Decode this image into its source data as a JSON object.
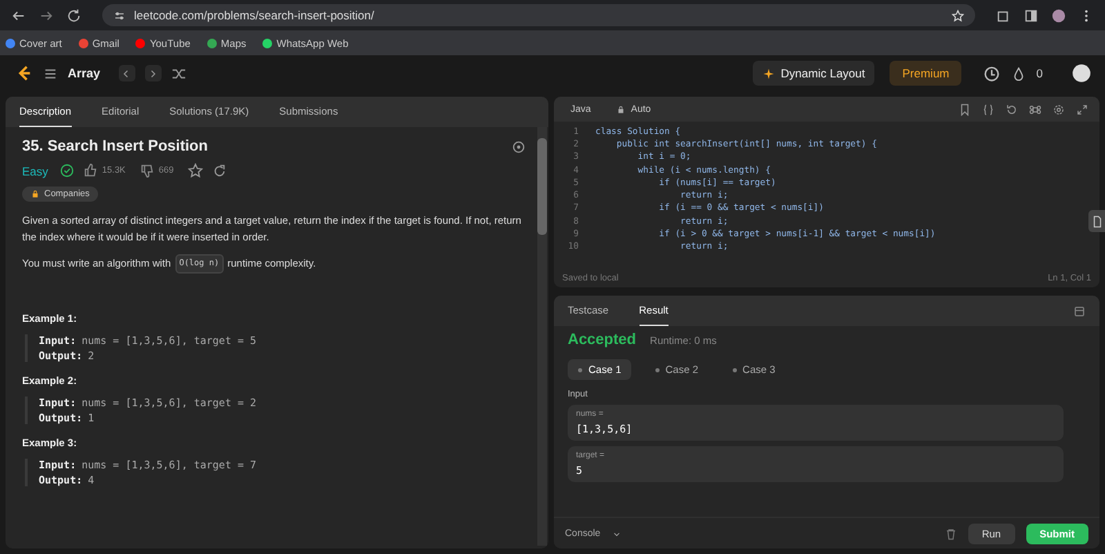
{
  "browser": {
    "url": "leetcode.com/problems/search-insert-position/",
    "bookmarks": [
      {
        "label": "Cover art",
        "color": "#4285f4"
      },
      {
        "label": "Gmail",
        "color": "#ea4335"
      },
      {
        "label": "YouTube",
        "color": "#ff0000"
      },
      {
        "label": "Maps",
        "color": "#34a853"
      },
      {
        "label": "WhatsApp Web",
        "color": "#25d366"
      }
    ]
  },
  "nav": {
    "title": "Array",
    "dynamic_layout": "Dynamic Layout",
    "premium": "Premium",
    "streak": "0"
  },
  "description": {
    "tabs": [
      {
        "label": "Description",
        "selected": true
      },
      {
        "label": "Editorial",
        "selected": false
      },
      {
        "label": "Solutions (17.9K)",
        "selected": false
      },
      {
        "label": "Submissions",
        "selected": false
      }
    ],
    "title": "35. Search Insert Position",
    "difficulty": "Easy",
    "solved": true,
    "likes": "15.3K",
    "dislikes": "669",
    "companies": "Companies",
    "statement": "Given a sorted array of distinct integers and a target value, return the index if the target is found. If not, return the index where it would be if it were inserted in order.",
    "complexity": {
      "before": "You must write an algorithm with",
      "code": "O(log n)",
      "after": "runtime complexity."
    },
    "examples": [
      {
        "title": "Example 1:",
        "input_label": "Input:",
        "input": "nums = [1,3,5,6], target = 5",
        "output_label": "Output:",
        "output": "2"
      },
      {
        "title": "Example 2:",
        "input_label": "Input:",
        "input": "nums = [1,3,5,6], target = 2",
        "output_label": "Output:",
        "output": "1"
      },
      {
        "title": "Example 3:",
        "input_label": "Input:",
        "input": "nums = [1,3,5,6], target = 7",
        "output_label": "Output:",
        "output": "4"
      }
    ]
  },
  "editor": {
    "language": "Java",
    "mode": "Auto",
    "lines": [
      {
        "num": "1",
        "text": "class Solution {"
      },
      {
        "num": "2",
        "text": "    public int searchInsert(int[] nums, int target) {"
      },
      {
        "num": "3",
        "text": "        int i = 0;"
      },
      {
        "num": "4",
        "text": "        while (i < nums.length) {"
      },
      {
        "num": "5",
        "text": "            if (nums[i] == target)"
      },
      {
        "num": "6",
        "text": "                return i;"
      },
      {
        "num": "7",
        "text": "            if (i == 0 && target < nums[i])"
      },
      {
        "num": "8",
        "text": "                return i;"
      },
      {
        "num": "9",
        "text": "            if (i > 0 && target > nums[i-1] && target < nums[i])"
      },
      {
        "num": "10",
        "text": "                return i;"
      }
    ],
    "status": "Saved to local",
    "position": "Ln 1, Col 1"
  },
  "result": {
    "tabs": [
      {
        "label": "Testcase",
        "selected": false
      },
      {
        "label": "Result",
        "selected": true
      }
    ],
    "verdict": "Accepted",
    "runtime": "Runtime: 0 ms",
    "cases": [
      {
        "label": "Case 1",
        "selected": true
      },
      {
        "label": "Case 2",
        "selected": false
      },
      {
        "label": "Case 3",
        "selected": false
      }
    ],
    "input_label": "Input",
    "params": [
      {
        "name": "nums =",
        "value": "[1,3,5,6]"
      },
      {
        "name": "target =",
        "value": "5"
      }
    ],
    "console": "Console",
    "run": "Run",
    "submit": "Submit"
  }
}
